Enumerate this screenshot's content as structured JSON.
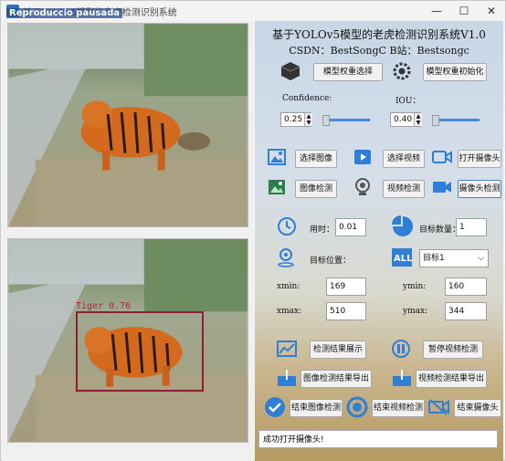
{
  "window": {
    "title": "基于YOLOv5模型的老虎检测识别系统",
    "watermark": "Reproduccio pausada",
    "controls": {
      "minimize": "—",
      "maximize": "☐",
      "close": "✕"
    }
  },
  "left": {
    "detection": {
      "label": "Tiger 0.76"
    }
  },
  "header": {
    "title": "基于YOLOv5模型的老虎检测识别系统V1.0",
    "subtitle": "CSDN：BestSongC   B站：Bestsongc"
  },
  "model": {
    "select_label": "模型权重选择",
    "init_label": "模型权重初始化",
    "confidence_label": "Confidence:",
    "confidence_value": "0.25",
    "iou_label": "IOU：",
    "iou_value": "0.40"
  },
  "actions": {
    "select_image": "选择图像",
    "select_video": "选择视频",
    "open_camera": "打开摄像头",
    "image_detect": "图像检测",
    "video_detect": "视频检测",
    "camera_detect": "摄像头检测"
  },
  "stats": {
    "time_label": "用时：",
    "time_value": "0.01",
    "count_label": "目标数量：",
    "count_value": "1",
    "position_label": "目标位置：",
    "target_select": "目标1",
    "xmin_label": "xmin:",
    "xmin_value": "169",
    "ymin_label": "ymin:",
    "ymin_value": "160",
    "xmax_label": "xmax:",
    "xmax_value": "510",
    "ymax_label": "ymax:",
    "ymax_value": "344"
  },
  "bottom": {
    "show_results": "检测结果展示",
    "pause_video": "暂停视频检测",
    "export_image": "图像检测结果导出",
    "export_video": "视频检测结果导出",
    "end_image": "结束图像检测",
    "end_video": "结束视频检测",
    "end_camera": "结束摄像头"
  },
  "status": {
    "message": "成功打开摄像头!"
  },
  "colors": {
    "accent": "#2f7fd6",
    "detection_box": "#8a2036"
  }
}
